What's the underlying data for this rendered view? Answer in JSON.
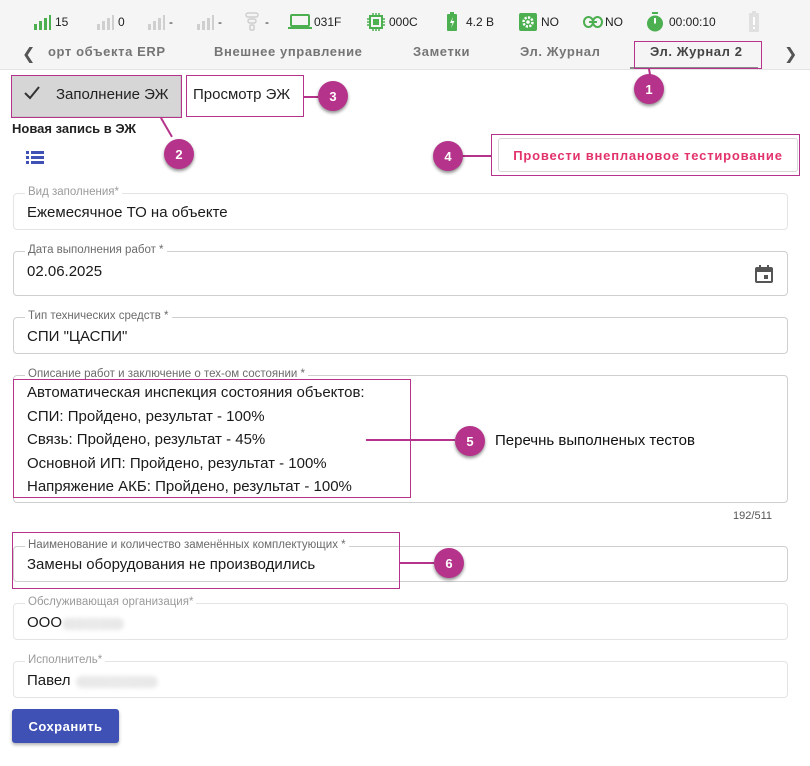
{
  "status_bar": {
    "signal1": "15",
    "signal2": "0",
    "signal3": "-",
    "signal4": "-",
    "wifi": "-",
    "device_id": "031F",
    "chip_code": "000C",
    "battery": "4.2 В",
    "settings_state": "NO",
    "link_state": "NO",
    "timer": "00:00:10"
  },
  "tabs": [
    {
      "label": "орт объекта ERP",
      "active": false
    },
    {
      "label": "Внешнее управление",
      "active": false
    },
    {
      "label": "Заметки",
      "active": false
    },
    {
      "label": "Эл. Журнал",
      "active": false
    },
    {
      "label": "Эл. Журнал 2",
      "active": true
    }
  ],
  "mode_toggle": {
    "fill_label": "Заполнение ЭЖ",
    "view_label": "Просмотр ЭЖ"
  },
  "section_title": "Новая запись в ЭЖ",
  "unplanned_test_button": "Провести внеплановое тестирование",
  "form": {
    "fill_type": {
      "label": "Вид заполнения*",
      "value": "Ежемесячное ТО на объекте"
    },
    "work_date": {
      "label": "Дата выполнения работ *",
      "value": "02.06.2025"
    },
    "tech_type": {
      "label": "Тип технических средств *",
      "value": "СПИ \"ЦАСПИ\""
    },
    "description": {
      "label": "Описание работ и заключение о тех-ом состоянии *",
      "lines": [
        "Автоматическая инспекция состояния объектов:",
        "СПИ: Пройдено, результат - 100%",
        "Связь: Пройдено, результат - 45%",
        "Основной ИП: Пройдено, результат - 100%",
        "Напряжение АКБ: Пройдено, результат - 100%"
      ],
      "counter": "192/511"
    },
    "replaced_parts": {
      "label": "Наименование и количество заменённых комплектующих *",
      "value": "Замены оборудования не производились"
    },
    "service_org": {
      "label": "Обслуживающая организация*",
      "value": "ООО"
    },
    "executor": {
      "label": "Исполнитель*",
      "value": "Павел"
    }
  },
  "annotations": {
    "badge1": "1",
    "badge2": "2",
    "badge3": "3",
    "badge4": "4",
    "badge5": "5",
    "badge6": "6",
    "note5": "Перечнь выполненых тестов"
  },
  "save_button": "Сохранить",
  "colors": {
    "accent_magenta": "#b5338a",
    "test_button_text": "#e3336b",
    "save_button_bg": "#3f51b5",
    "signal_green": "#4caf50"
  },
  "icons": [
    "signal-bars-icon",
    "wifi-icon",
    "laptop-icon",
    "chip-icon",
    "battery-icon",
    "gear-icon",
    "link-icon",
    "stopwatch-icon",
    "checkmark-icon",
    "list-icon",
    "calendar-icon",
    "chevron-left-icon",
    "chevron-right-icon"
  ]
}
